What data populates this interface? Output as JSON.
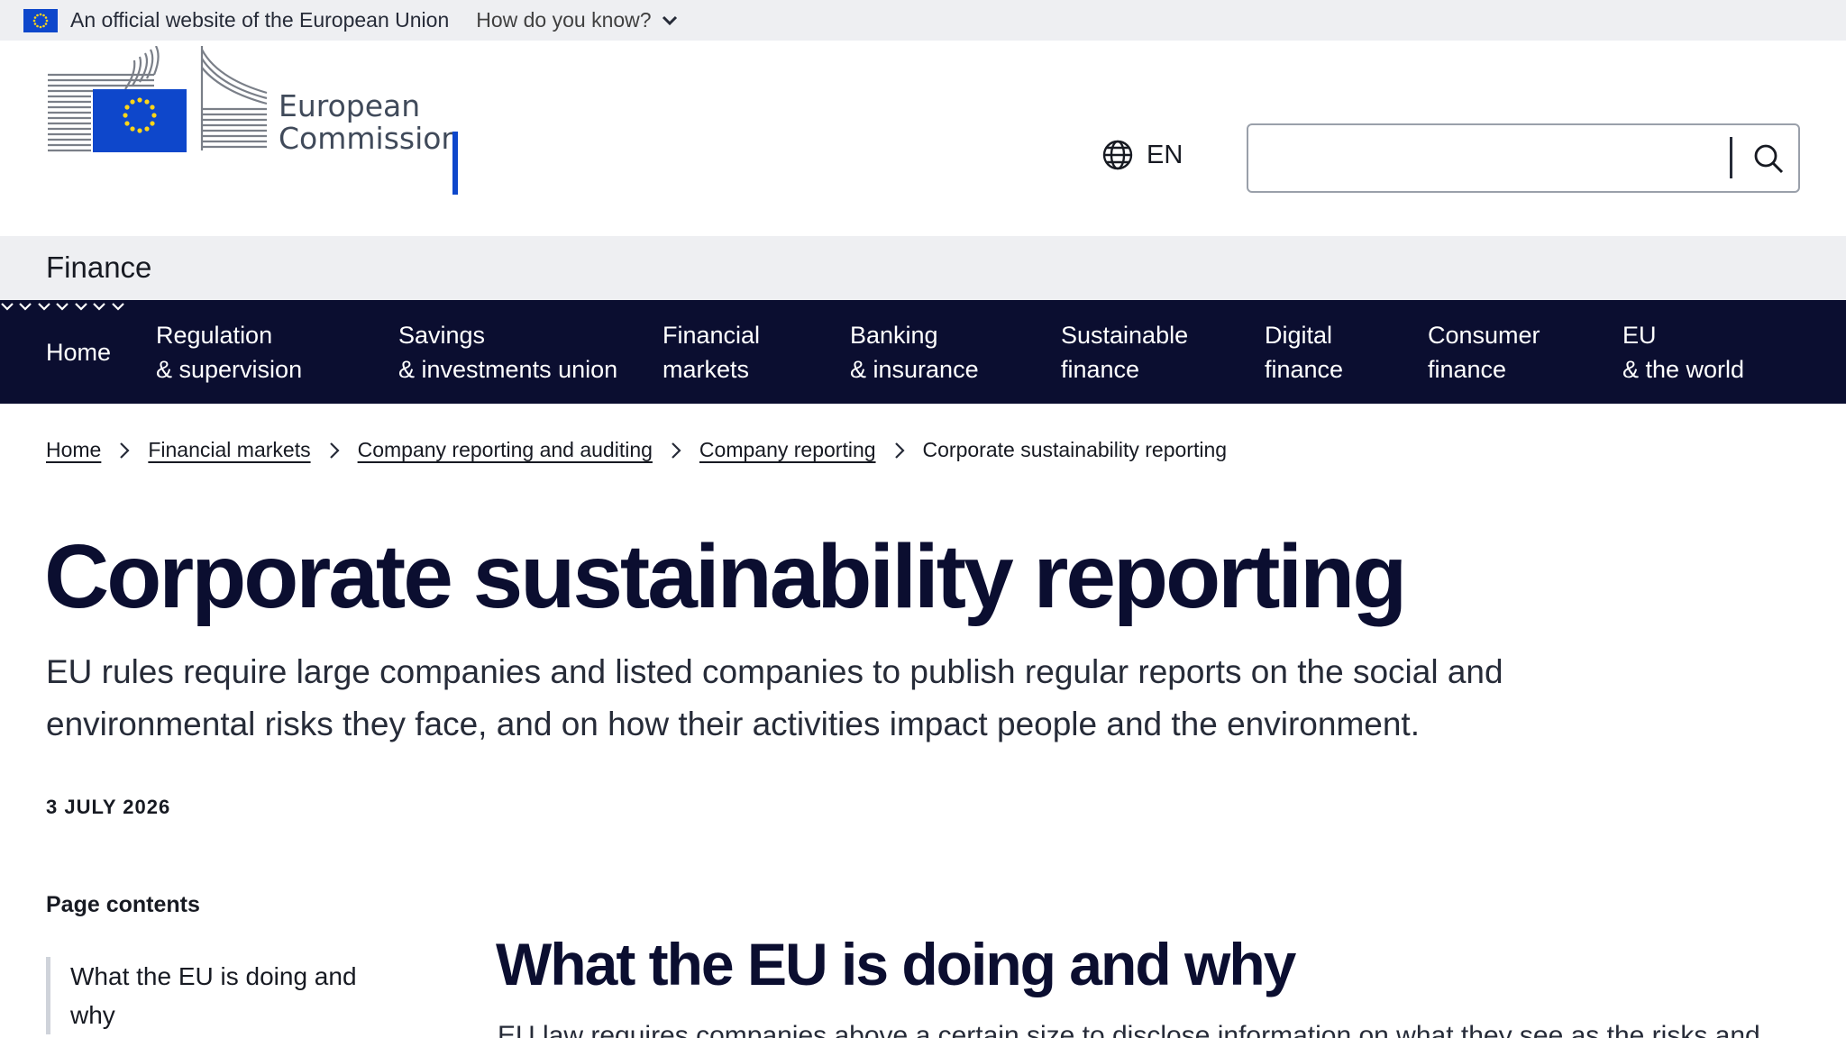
{
  "official_banner": {
    "text": "An official website of the European Union",
    "how_know": "How do you know?"
  },
  "header": {
    "logo_line1": "European",
    "logo_line2": "Commission",
    "language": "EN",
    "search_placeholder": ""
  },
  "site_name": "Finance",
  "nav": {
    "items": [
      {
        "label": "Home"
      },
      {
        "label": "Regulation\n& supervision"
      },
      {
        "label": "Savings\n& investments union"
      },
      {
        "label": "Financial\nmarkets"
      },
      {
        "label": "Banking\n& insurance"
      },
      {
        "label": "Sustainable\nfinance"
      },
      {
        "label": "Digital\nfinance"
      },
      {
        "label": "Consumer\nfinance"
      },
      {
        "label": "EU\n& the world"
      }
    ]
  },
  "breadcrumb": {
    "items": [
      "Home",
      "Financial markets",
      "Company reporting and auditing",
      "Company reporting"
    ],
    "current": "Corporate sustainability reporting"
  },
  "page": {
    "title": "Corporate sustainability reporting",
    "lead": "EU rules require large companies and listed companies to publish regular reports on the social and environmental risks they face, and on how their activities impact people and  the environment.",
    "date": "3 JULY 2026"
  },
  "page_contents": {
    "heading": "Page contents",
    "items": [
      "What the EU is doing and why"
    ]
  },
  "section": {
    "title": "What the EU is doing and why",
    "text": "EU law requires companies above a certain size to disclose information on what they see as the risks and"
  },
  "colors": {
    "nav_bg": "#0b0e30",
    "eu_blue": "#0e47cb",
    "eu_yellow": "#ffd617",
    "band_grey": "#eeeff2"
  }
}
